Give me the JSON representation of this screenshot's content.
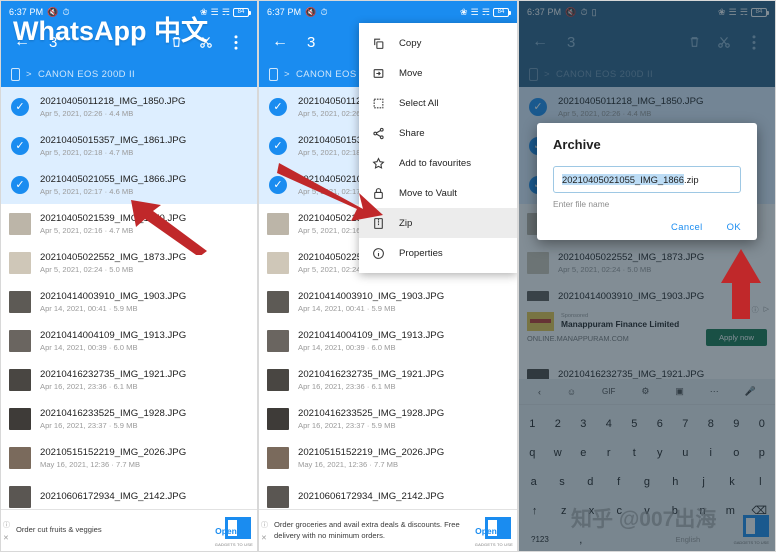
{
  "status_bar": {
    "time": "6:37 PM",
    "left_icons": [
      "mute-icon",
      "alarm-icon"
    ],
    "left_icons_extra": [
      "keyboard-icon"
    ],
    "right_icons": [
      "bluetooth-icon",
      "signal-icon",
      "wifi-icon"
    ],
    "battery_level": "84"
  },
  "app_bar": {
    "back_label": "←",
    "selection_count": "3",
    "icons": [
      "delete-icon",
      "cut-icon",
      "overflow-icon"
    ]
  },
  "breadcrumb": {
    "device_icon": "phone-icon",
    "separator": ">",
    "path": "CANON EOS 200D II"
  },
  "files": [
    {
      "name": "20210405011218_IMG_1850.JPG",
      "sub": "Apr 5, 2021, 02:26  ·  4.4 MB",
      "selected": true,
      "thumb": "#a8a49c"
    },
    {
      "name": "20210405015357_IMG_1861.JPG",
      "sub": "Apr 5, 2021, 02:18  ·  4.7 MB",
      "selected": true,
      "thumb": "#9c9890"
    },
    {
      "name": "20210405021055_IMG_1866.JPG",
      "sub": "Apr 5, 2021, 02:17  ·  4.6 MB",
      "selected": true,
      "thumb": "#b0aca2"
    },
    {
      "name": "20210405021539_IMG_1870.JPG",
      "sub": "Apr 5, 2021, 02:16  ·  4.7 MB",
      "selected": false,
      "thumb": "#bcb5a8"
    },
    {
      "name": "20210405022552_IMG_1873.JPG",
      "sub": "Apr 5, 2021, 02:24  ·  5.0 MB",
      "selected": false,
      "thumb": "#cfc7b8"
    },
    {
      "name": "20210414003910_IMG_1903.JPG",
      "sub": "Apr 14, 2021, 00:41  ·  5.9 MB",
      "selected": false,
      "thumb": "#5d5a55"
    },
    {
      "name": "20210414004109_IMG_1913.JPG",
      "sub": "Apr 14, 2021, 00:39  ·  6.0 MB",
      "selected": false,
      "thumb": "#6a6560"
    },
    {
      "name": "20210416232735_IMG_1921.JPG",
      "sub": "Apr 16, 2021, 23:36  ·  6.1 MB",
      "selected": false,
      "thumb": "#494642"
    },
    {
      "name": "20210416233525_IMG_1928.JPG",
      "sub": "Apr 16, 2021, 23:37  ·  5.9 MB",
      "selected": false,
      "thumb": "#3e3b38"
    },
    {
      "name": "20210515152219_IMG_2026.JPG",
      "sub": "May 16, 2021, 12:36  ·  7.7 MB",
      "selected": false,
      "thumb": "#7a6a5c"
    },
    {
      "name": "20210606172934_IMG_2142.JPG",
      "sub": "",
      "selected": false,
      "thumb": "#5a5652"
    }
  ],
  "context_menu": {
    "items": [
      {
        "label": "Copy",
        "icon": "copy-icon",
        "highlighted": false
      },
      {
        "label": "Move",
        "icon": "move-icon",
        "highlighted": false
      },
      {
        "label": "Select All",
        "icon": "select-all-icon",
        "highlighted": false
      },
      {
        "label": "Share",
        "icon": "share-icon",
        "highlighted": false
      },
      {
        "label": "Add to favourites",
        "icon": "star-icon",
        "highlighted": false
      },
      {
        "label": "Move to Vault",
        "icon": "lock-icon",
        "highlighted": false
      },
      {
        "label": "Zip",
        "icon": "zip-icon",
        "highlighted": true
      },
      {
        "label": "Properties",
        "icon": "info-icon",
        "highlighted": false
      }
    ]
  },
  "archive_dialog": {
    "title": "Archive",
    "filename_selected": "20210405021055_IMG_1866",
    "filename_extension": ".zip",
    "hint": "Enter file name",
    "cancel_label": "Cancel",
    "ok_label": "OK"
  },
  "ads": {
    "panel1": {
      "text": "Order cut fruits & veggies",
      "badge_label": "Open",
      "badge_caption": "GADGETS TO USE"
    },
    "panel2": {
      "text": "Order groceries and avail extra deals & discounts. Free delivery with no minimum orders.",
      "badge_label": "Open",
      "badge_caption": "GADGETS TO USE"
    },
    "panel3": {
      "sponsored_label": "Sponsored",
      "advertiser": "Manappuram Finance Limited",
      "url": "ONLINE.MANAPPURAM.COM",
      "cta_label": "Apply now"
    }
  },
  "keyboard": {
    "toolbar_icons": [
      "chevron-left-icon",
      "sticker-icon",
      "GIF",
      "gear-icon",
      "translate-icon",
      "more-icon",
      "mic-icon"
    ],
    "row_numbers": [
      "1",
      "2",
      "3",
      "4",
      "5",
      "6",
      "7",
      "8",
      "9",
      "0"
    ],
    "row_top": [
      "q",
      "w",
      "e",
      "r",
      "t",
      "y",
      "u",
      "i",
      "o",
      "p"
    ],
    "row_home": [
      "a",
      "s",
      "d",
      "f",
      "g",
      "h",
      "j",
      "k",
      "l"
    ],
    "row_bottom": [
      "z",
      "x",
      "c",
      "v",
      "b",
      "n",
      "m"
    ],
    "shift_label": "↑",
    "backspace_label": "⌫",
    "symbols_label": "?123",
    "comma_label": ",",
    "space_label": "English"
  },
  "watermarks": {
    "title": "WhatsApp 中文",
    "keyboard": "知乎 @007出海"
  },
  "colors": {
    "accent_blue": "#1a8cf0",
    "selected_row": "#ddeeff",
    "dim_blue": "#2b5f87",
    "arrow_red": "#c0282a",
    "highlight_text": "#bcdcf5"
  }
}
